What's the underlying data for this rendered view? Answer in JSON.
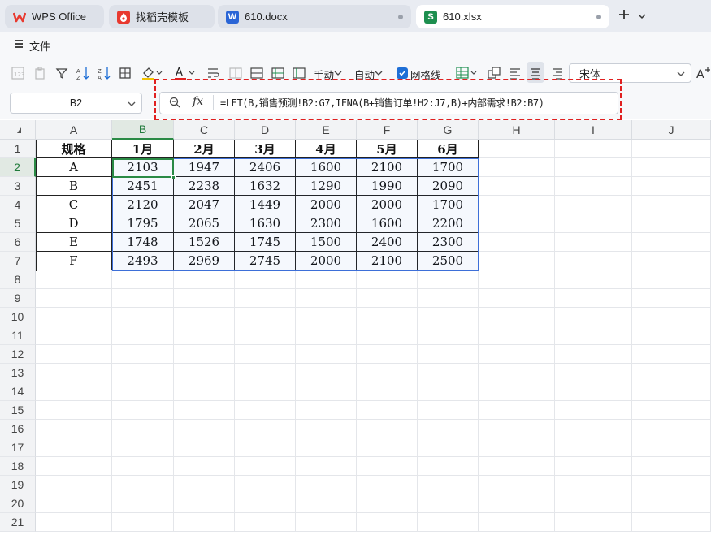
{
  "tabs": [
    {
      "label": "WPS Office",
      "icon": "wps-logo-icon",
      "color": "#e8392f"
    },
    {
      "label": "找稻壳模板",
      "icon": "docer-icon",
      "color": "#e8392f"
    },
    {
      "label": "610.docx",
      "icon": "word-doc-icon",
      "color": "#2a65d6"
    },
    {
      "label": "610.xlsx",
      "icon": "spreadsheet-icon",
      "color": "#1d8f4f",
      "active": true
    }
  ],
  "tab_icon_letters": {
    "word": "W",
    "sheet": "S"
  },
  "menu": {
    "file_label": "文件"
  },
  "toolbar": {
    "manual_label": "手动",
    "auto_label": "自动",
    "gridlines_label": "网格线",
    "gridlines_checked": true,
    "font_name": "宋体"
  },
  "formula_bar": {
    "name_box": "B2",
    "fx": "fx",
    "formula": "=LET(B,销售预测!B2:G7,IFNA(B+销售订单!H2:J7,B)+内部需求!B2:B7)"
  },
  "sheet": {
    "columns": [
      "A",
      "B",
      "C",
      "D",
      "E",
      "F",
      "G",
      "H",
      "I",
      "J"
    ],
    "rows": [
      "1",
      "2",
      "3",
      "4",
      "5",
      "6",
      "7",
      "8",
      "9",
      "10",
      "11",
      "12",
      "13",
      "14",
      "15",
      "16",
      "17",
      "18",
      "19",
      "20",
      "21"
    ],
    "selected_cell": "B2",
    "header": [
      "规格",
      "1月",
      "2月",
      "3月",
      "4月",
      "5月",
      "6月"
    ],
    "data": [
      [
        "A",
        "2103",
        "1947",
        "2406",
        "1600",
        "2100",
        "1700"
      ],
      [
        "B",
        "2451",
        "2238",
        "1632",
        "1290",
        "1990",
        "2090"
      ],
      [
        "C",
        "2120",
        "2047",
        "1449",
        "2000",
        "2000",
        "1700"
      ],
      [
        "D",
        "1795",
        "2065",
        "1630",
        "2300",
        "1600",
        "2200"
      ],
      [
        "E",
        "1748",
        "1526",
        "1745",
        "1500",
        "2400",
        "2300"
      ],
      [
        "F",
        "2493",
        "2969",
        "2745",
        "2000",
        "2100",
        "2500"
      ]
    ]
  },
  "colors": {
    "selection_green": "#2a8a45",
    "range_blue": "#3d6fd8",
    "highlight_red": "#e02020"
  }
}
